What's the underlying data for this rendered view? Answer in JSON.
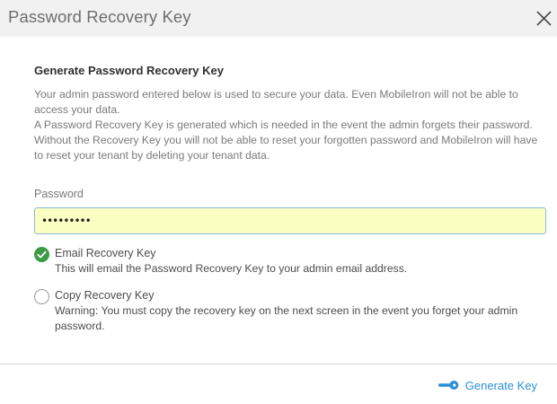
{
  "dialog": {
    "title": "Password Recovery Key",
    "close_icon": "close-icon"
  },
  "section": {
    "heading": "Generate Password Recovery Key",
    "description": [
      "Your admin password entered below is used to secure your data. Even MobileIron will not be able to access your data.",
      "A Password Recovery Key is generated which is needed in the event the admin forgets their password.",
      "Without the Recovery Key you will not be able to reset your forgotten password and MobileIron will have to reset your tenant by deleting your tenant data."
    ]
  },
  "password": {
    "label": "Password",
    "value": "•••••••••"
  },
  "options": [
    {
      "title": "Email Recovery Key",
      "description": "This will email the Password Recovery Key to your admin email address.",
      "selected": true
    },
    {
      "title": "Copy Recovery Key",
      "description": "Warning: You must copy the recovery key on the next screen in the event you forget your admin password.",
      "selected": false
    }
  ],
  "footer": {
    "generate_label": "Generate Key",
    "generate_icon": "key-icon"
  },
  "colors": {
    "accent": "#2b8fd6",
    "radio_checked": "#3d9b46",
    "input_background": "#fbffc1",
    "titlebar_background": "#f1f1f1"
  }
}
